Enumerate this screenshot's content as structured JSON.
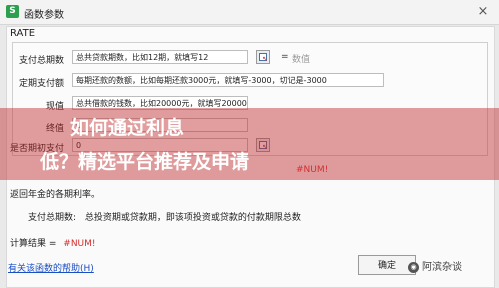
{
  "window": {
    "app_icon": "S",
    "title": "函数参数",
    "close": "×"
  },
  "function_name": "RATE",
  "args": [
    {
      "label": "支付总期数",
      "value": "总共贷款期数，比如12期，就填写12",
      "preview": "数值"
    },
    {
      "label": "定期支付额",
      "value": "每期还款的数额，比如每期还款3000元，就填写-3000，切记是-3000",
      "preview": ""
    },
    {
      "label": "现值",
      "value": "总共借款的钱数，比如20000元，就填写20000",
      "preview": ""
    },
    {
      "label": "终值",
      "value": "0",
      "preview": ""
    },
    {
      "label": "是否期初支付",
      "value": "0",
      "preview": ""
    }
  ],
  "result_preview": "#NUM!",
  "overlay": {
    "line1": "如何通过利息",
    "line2": "低？精选平台推荐及申请"
  },
  "description": "返回年金的各期利率。",
  "arg_description": {
    "label": "支付总期数:",
    "text": "总投资期或贷款期，即该项投资或贷款的付款期限总数"
  },
  "calc_result": {
    "label": "计算结果 =",
    "value": "#NUM!"
  },
  "help_link": "有关该函数的帮助(H)",
  "ok_button": "确定",
  "watermark": "阿滨杂谈"
}
